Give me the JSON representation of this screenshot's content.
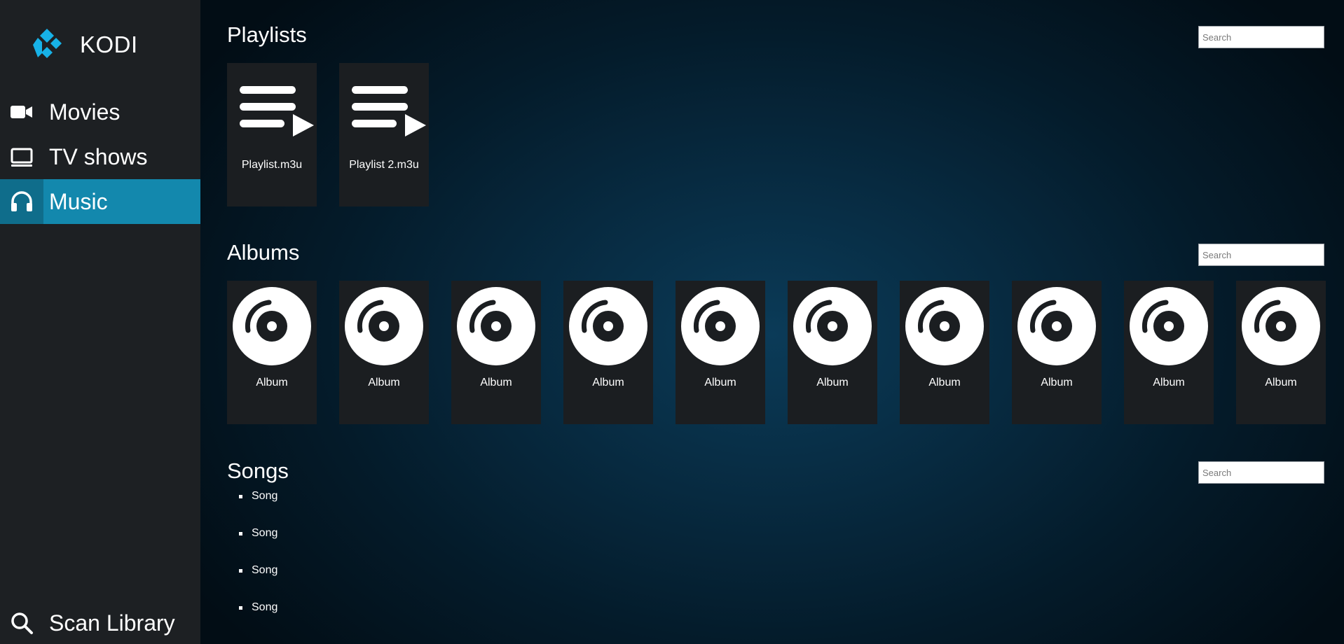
{
  "app": {
    "name": "KODI",
    "accent_color": "#1388ad",
    "sidebar_color": "#1d2023"
  },
  "sidebar": {
    "items": [
      {
        "label": "Movies",
        "icon": "video-camera-icon",
        "active": false
      },
      {
        "label": "TV shows",
        "icon": "monitor-icon",
        "active": false
      },
      {
        "label": "Music",
        "icon": "headphones-icon",
        "active": true
      }
    ],
    "footer_item": {
      "label": "Scan Library",
      "icon": "search-icon"
    }
  },
  "sections": {
    "playlists": {
      "title": "Playlists",
      "search_placeholder": "Search",
      "items": [
        {
          "label": "Playlist.m3u",
          "icon": "playlist-play-icon"
        },
        {
          "label": "Playlist 2.m3u",
          "icon": "playlist-play-icon"
        }
      ]
    },
    "albums": {
      "title": "Albums",
      "search_placeholder": "Search",
      "items": [
        {
          "label": "Album",
          "icon": "disc-icon"
        },
        {
          "label": "Album",
          "icon": "disc-icon"
        },
        {
          "label": "Album",
          "icon": "disc-icon"
        },
        {
          "label": "Album",
          "icon": "disc-icon"
        },
        {
          "label": "Album",
          "icon": "disc-icon"
        },
        {
          "label": "Album",
          "icon": "disc-icon"
        },
        {
          "label": "Album",
          "icon": "disc-icon"
        },
        {
          "label": "Album",
          "icon": "disc-icon"
        },
        {
          "label": "Album",
          "icon": "disc-icon"
        },
        {
          "label": "Album",
          "icon": "disc-icon"
        }
      ]
    },
    "songs": {
      "title": "Songs",
      "search_placeholder": "Search",
      "items": [
        "Song",
        "Song",
        "Song",
        "Song"
      ]
    }
  }
}
